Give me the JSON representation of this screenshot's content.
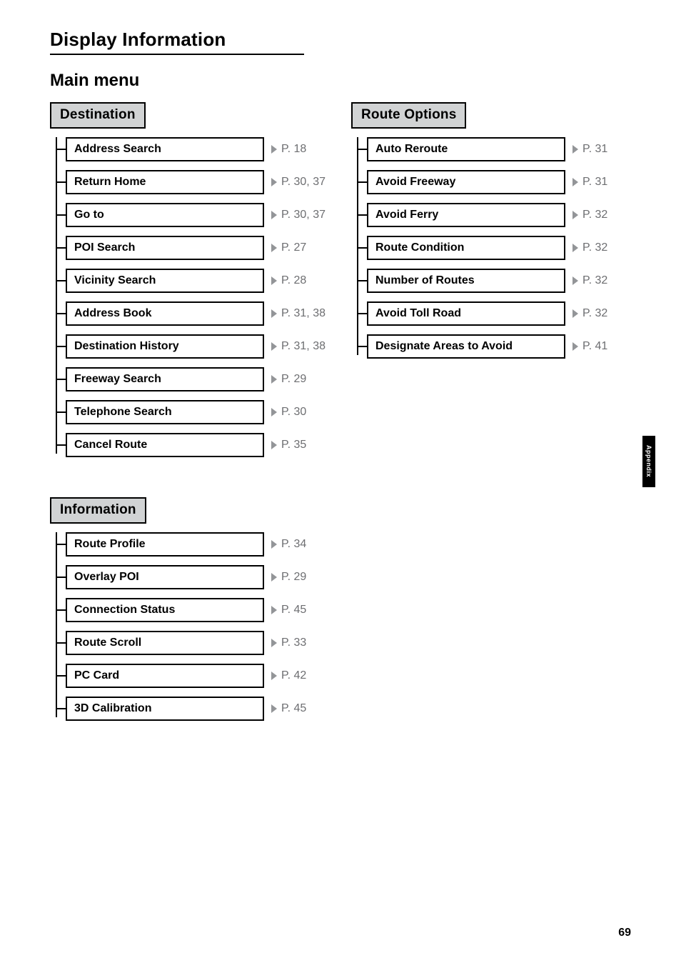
{
  "title": "Display Information",
  "subtitle": "Main menu",
  "sections": {
    "destination": {
      "header": "Destination",
      "items": [
        {
          "label": "Address Search",
          "page": "P. 18"
        },
        {
          "label": "Return Home",
          "page": "P. 30, 37"
        },
        {
          "label": "Go to",
          "page": "P. 30, 37"
        },
        {
          "label": "POI Search",
          "page": "P. 27"
        },
        {
          "label": "Vicinity Search",
          "page": "P. 28"
        },
        {
          "label": "Address Book",
          "page": "P. 31, 38"
        },
        {
          "label": "Destination History",
          "page": "P. 31, 38"
        },
        {
          "label": "Freeway Search",
          "page": "P. 29"
        },
        {
          "label": "Telephone Search",
          "page": "P. 30"
        },
        {
          "label": "Cancel Route",
          "page": "P. 35"
        }
      ]
    },
    "route_options": {
      "header": "Route Options",
      "items": [
        {
          "label": "Auto Reroute",
          "page": "P. 31"
        },
        {
          "label": "Avoid Freeway",
          "page": "P. 31"
        },
        {
          "label": "Avoid Ferry",
          "page": "P. 32"
        },
        {
          "label": "Route Condition",
          "page": "P. 32"
        },
        {
          "label": "Number of Routes",
          "page": "P. 32"
        },
        {
          "label": "Avoid Toll Road",
          "page": "P. 32"
        },
        {
          "label": "Designate Areas to Avoid",
          "page": "P. 41"
        }
      ]
    },
    "information": {
      "header": "Information",
      "items": [
        {
          "label": "Route Profile",
          "page": "P. 34"
        },
        {
          "label": "Overlay POI",
          "page": "P. 29"
        },
        {
          "label": "Connection Status",
          "page": "P. 45"
        },
        {
          "label": "Route Scroll",
          "page": "P. 33"
        },
        {
          "label": "PC Card",
          "page": "P. 42"
        },
        {
          "label": "3D Calibration",
          "page": "P. 45"
        }
      ]
    }
  },
  "side_tab": "Appendix",
  "page_number": "69"
}
